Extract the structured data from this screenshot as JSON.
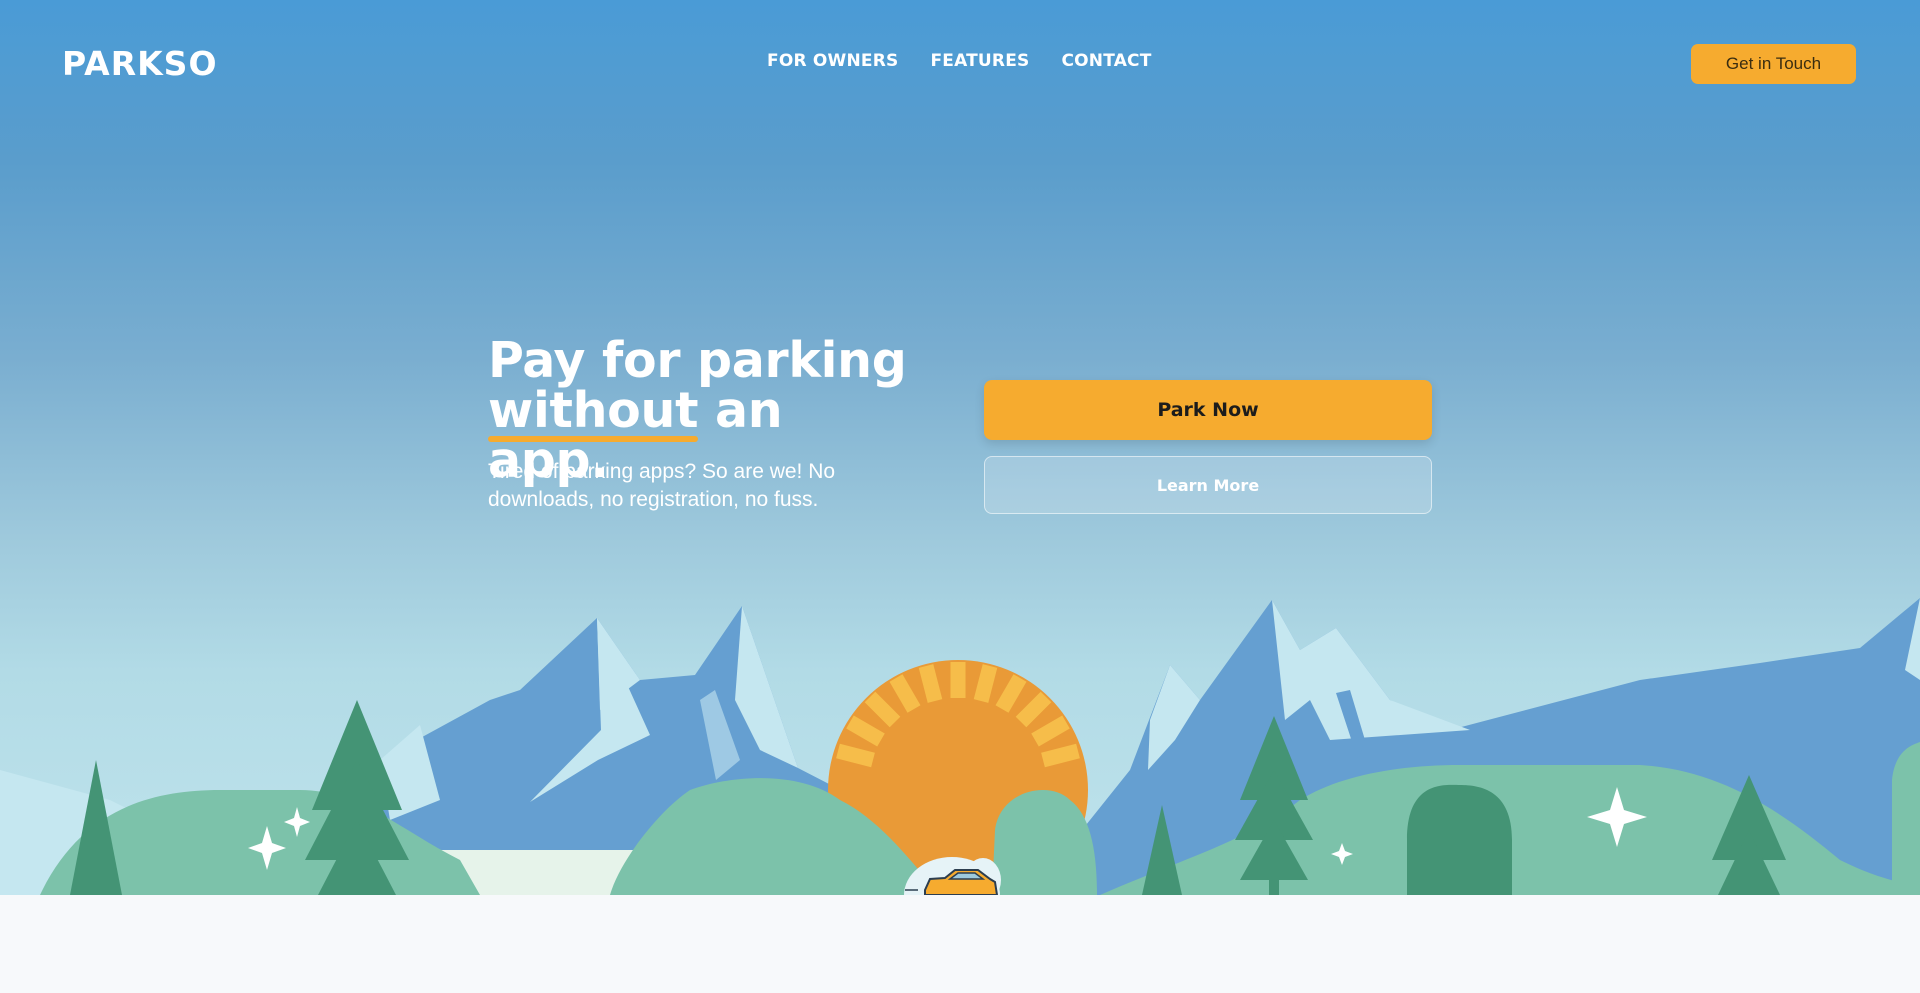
{
  "brand": {
    "logo": "PARKSO"
  },
  "nav": {
    "links": [
      "FOR OWNERS",
      "FEATURES",
      "CONTACT"
    ],
    "cta_label": "Get in Touch"
  },
  "hero": {
    "headline_line1": "Pay for parking",
    "headline_emph": "without",
    "headline_rest": " an app.",
    "subtext": "Tired of parking apps? So are we! No downloads, no registration, no fuss.",
    "primary_cta": "Park Now",
    "secondary_cta": "Learn More"
  },
  "colors": {
    "accent": "#f6ab2f",
    "sky_top": "#4a9bd6",
    "mountain": "#659fd1",
    "snow": "#c5e7f0",
    "hill": "#7cc2aa",
    "tree": "#449475",
    "sun": "#e99a37"
  },
  "icons": [
    "sparkle-icon",
    "car-icon",
    "tree-icon",
    "sun-icon",
    "mountain-icon"
  ]
}
